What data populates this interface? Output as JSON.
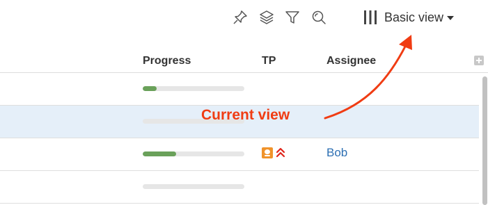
{
  "toolbar": {
    "icons": [
      "pin-icon",
      "layers-icon",
      "filter-icon",
      "search-icon",
      "columns-icon"
    ],
    "view_label": "Basic view"
  },
  "table": {
    "columns": [
      "Progress",
      "TP",
      "Assignee"
    ],
    "rows": [
      {
        "progress": 0.14,
        "selected": false,
        "assignee": ""
      },
      {
        "progress": 0.0,
        "selected": true,
        "assignee": ""
      },
      {
        "progress": 0.33,
        "selected": false,
        "assignee": "Bob",
        "tp_icon": "tp-user-icon",
        "priority_icon": "highest-priority-icon"
      },
      {
        "progress": 0.0,
        "selected": false,
        "assignee": ""
      }
    ]
  },
  "annotation": {
    "text": "Current view",
    "color": "#f03c13"
  },
  "colors": {
    "progress_fill": "#6aa15a",
    "selected_row": "#e5eff9",
    "link": "#2d6fb3"
  }
}
